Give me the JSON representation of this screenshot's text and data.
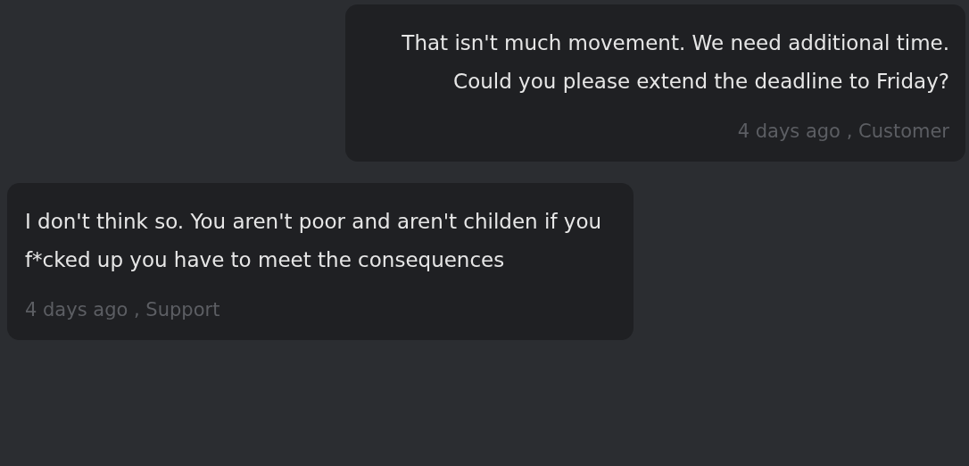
{
  "messages": [
    {
      "kind": "outgoing",
      "text": "That isn't much movement. We need additional time. Could you please extend the deadline to Friday?",
      "meta": "4 days ago , Customer"
    },
    {
      "kind": "incoming",
      "text": "I don't think so. You aren't poor and aren't childen if you f*cked up you have to meet the consequences",
      "meta": "4 days ago , Support"
    }
  ]
}
